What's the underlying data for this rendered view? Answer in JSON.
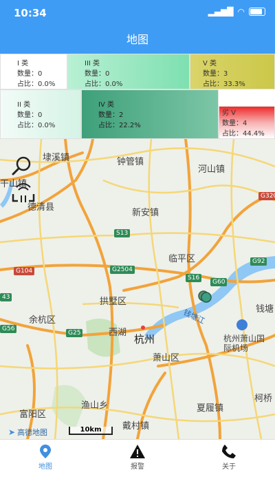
{
  "status": {
    "time": "10:34"
  },
  "nav": {
    "title": "地图"
  },
  "legend": [
    {
      "title": "I 类",
      "count": "数量：0",
      "ratio": "占比：0.0%"
    },
    {
      "title": "III 类",
      "count": "数量：0",
      "ratio": "占比：0.0%"
    },
    {
      "title": "V 类",
      "count": "数量：3",
      "ratio": "占比：33.3%"
    },
    {
      "title": "II 类",
      "count": "数量：0",
      "ratio": "占比：0.0%"
    },
    {
      "title": "IV 类",
      "count": "数量：2",
      "ratio": "占比：22.2%"
    },
    {
      "title": "劣 V",
      "count": "数量：4",
      "ratio": "占比：44.4%"
    }
  ],
  "map": {
    "places": [
      "埭溪镇",
      "钟管镇",
      "河山镇",
      "干山镇",
      "德清县",
      "新安镇",
      "临平区",
      "拱墅区",
      "余杭区",
      "西湖",
      "杭州",
      "萧山区",
      "钱塘",
      "杭州萧山国际机场",
      "富阳区",
      "渔山乡",
      "夏履镇",
      "戴村镇",
      "柯桥",
      "钱塘江"
    ],
    "roads": [
      "S13",
      "G2504",
      "S16",
      "G60",
      "G92",
      "G104",
      "G56",
      "G25",
      "G320",
      "43"
    ],
    "attribution": "高德地图",
    "scale": "10km"
  },
  "tabs": [
    {
      "label": "地图"
    },
    {
      "label": "报警"
    },
    {
      "label": "关于"
    }
  ]
}
